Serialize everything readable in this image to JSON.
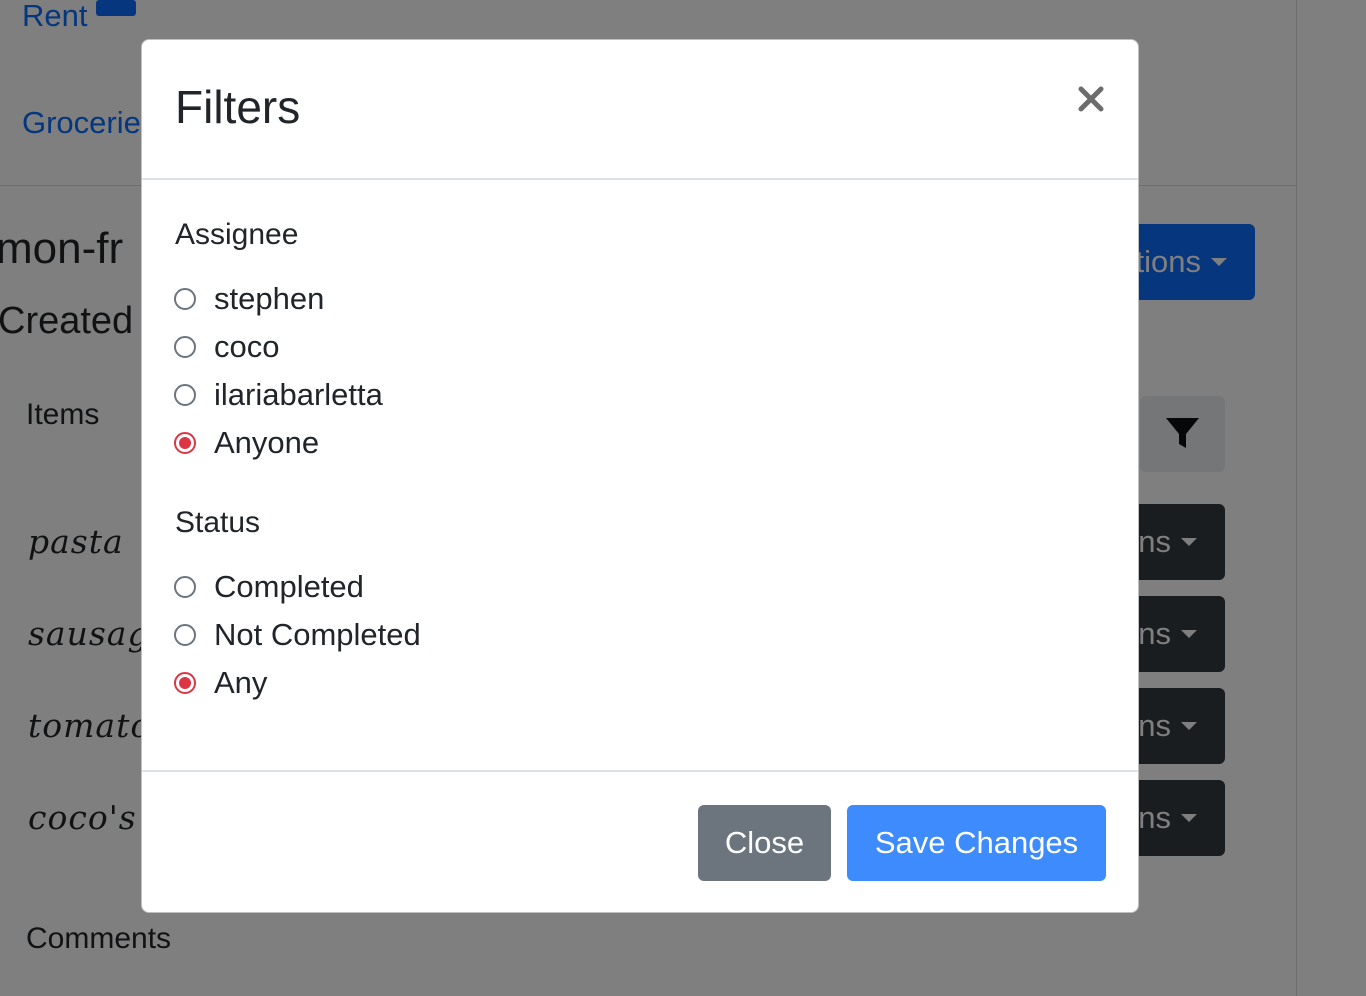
{
  "background": {
    "rows": [
      {
        "label": "Rent"
      },
      {
        "label": "Grocerie"
      }
    ],
    "heading": "mon-fr",
    "subheading": "Created",
    "items_label": "Items",
    "actions_label": "tions",
    "item_actions_label": "ns",
    "items": [
      "pasta",
      "sausag",
      "tomato",
      "coco's f"
    ],
    "comments_label": "Comments"
  },
  "modal": {
    "title": "Filters",
    "assignee": {
      "label": "Assignee",
      "options": [
        "stephen",
        "coco",
        "ilariabarletta",
        "Anyone"
      ],
      "selected": "Anyone"
    },
    "status": {
      "label": "Status",
      "options": [
        "Completed",
        "Not Completed",
        "Any"
      ],
      "selected": "Any"
    },
    "footer": {
      "close_label": "Close",
      "save_label": "Save Changes"
    }
  },
  "colors": {
    "primary": "#0d6efd",
    "radio_checked": "#dc3545",
    "secondary": "#6c757d"
  }
}
